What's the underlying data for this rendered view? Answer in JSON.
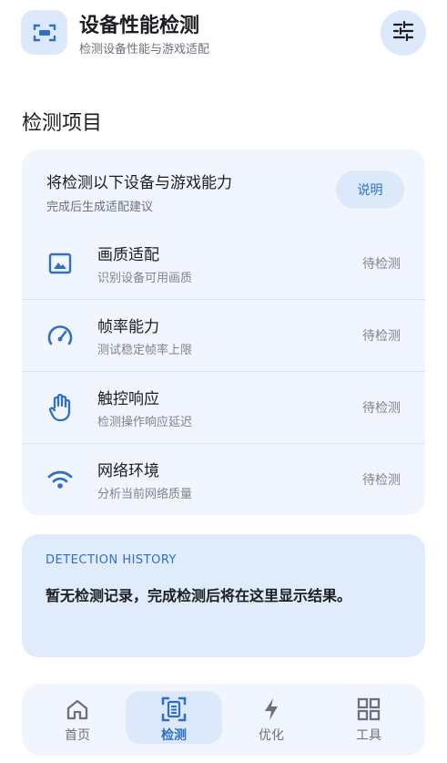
{
  "header": {
    "title": "设备性能检测",
    "subtitle": "检测设备性能与游戏适配",
    "app_icon": "scan-screen-icon",
    "settings_icon": "tune-sliders-icon"
  },
  "section": {
    "title": "检测项目"
  },
  "card": {
    "title": "将检测以下设备与游戏能力",
    "subtitle": "完成后生成适配建议",
    "explain_label": "说明",
    "items": [
      {
        "icon": "image-icon",
        "title": "画质适配",
        "subtitle": "识别设备可用画质",
        "status": "待检测"
      },
      {
        "icon": "speedometer-icon",
        "title": "帧率能力",
        "subtitle": "测试稳定帧率上限",
        "status": "待检测"
      },
      {
        "icon": "hand-touch-icon",
        "title": "触控响应",
        "subtitle": "检测操作响应延迟",
        "status": "待检测"
      },
      {
        "icon": "wifi-icon",
        "title": "网络环境",
        "subtitle": "分析当前网络质量",
        "status": "待检测"
      }
    ]
  },
  "history": {
    "label": "DETECTION HISTORY",
    "empty_text": "暂无检测记录，完成检测后将在这里显示结果。"
  },
  "nav": {
    "items": [
      {
        "icon": "home-icon",
        "label": "首页",
        "active": false
      },
      {
        "icon": "scan-document-icon",
        "label": "检测",
        "active": true
      },
      {
        "icon": "lightning-icon",
        "label": "优化",
        "active": false
      },
      {
        "icon": "grid-icon",
        "label": "工具",
        "active": false
      }
    ]
  },
  "colors": {
    "accent": "#2f6fc6",
    "card_bg": "#f1f6fe",
    "chip_bg": "#dce9fb",
    "history_bg": "#e0ecfc"
  }
}
